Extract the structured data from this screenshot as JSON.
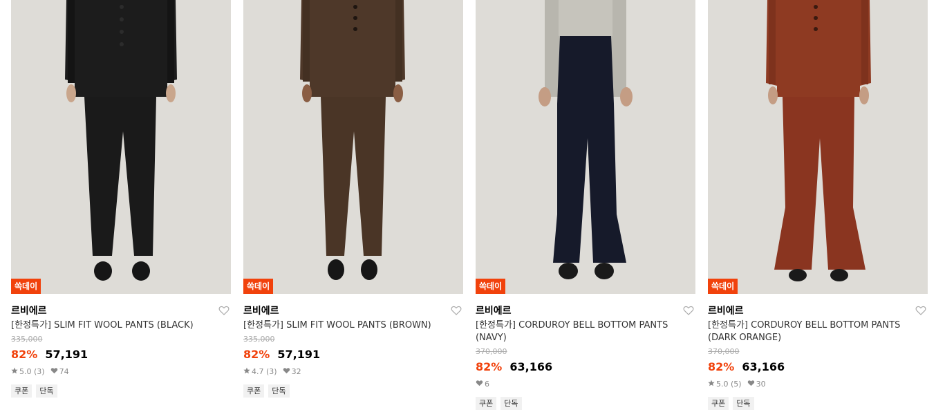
{
  "products": [
    {
      "badge": "쏙데이",
      "brand": "르비에르",
      "name": "[한정특가] SLIM FIT WOOL PANTS (BLACK)",
      "original_price": "335,000",
      "discount": "82%",
      "price": "57,191",
      "rating": "5.0",
      "review_count": "(3)",
      "likes": "74",
      "tags": [
        "쿠폰",
        "단독"
      ],
      "colors": {
        "bg": "#dedcd7",
        "garment": "#1c1c1c",
        "pants": "#1a1a1a"
      }
    },
    {
      "badge": "쏙데이",
      "brand": "르비에르",
      "name": "[한정특가] SLIM FIT WOOL PANTS (BROWN)",
      "original_price": "335,000",
      "discount": "82%",
      "price": "57,191",
      "rating": "4.7",
      "review_count": "(3)",
      "likes": "32",
      "tags": [
        "쿠폰",
        "단독"
      ],
      "colors": {
        "bg": "#dedcd7",
        "garment": "#4e3829",
        "pants": "#4a3526"
      }
    },
    {
      "badge": "쏙데이",
      "brand": "르비에르",
      "name": "[한정특가] CORDUROY BELL BOTTOM PANTS (NAVY)",
      "original_price": "370,000",
      "discount": "82%",
      "price": "63,166",
      "rating": "",
      "review_count": "",
      "likes": "6",
      "tags": [
        "쿠폰",
        "단독"
      ],
      "colors": {
        "bg": "#dedcd7",
        "garment": "#b8b6ae",
        "pants": "#161a2a"
      }
    },
    {
      "badge": "쏙데이",
      "brand": "르비에르",
      "name": "[한정특가] CORDUROY BELL BOTTOM PANTS (DARK ORANGE)",
      "original_price": "370,000",
      "discount": "82%",
      "price": "63,166",
      "rating": "5.0",
      "review_count": "(5)",
      "likes": "30",
      "tags": [
        "쿠폰",
        "단독"
      ],
      "colors": {
        "bg": "#dedcd7",
        "garment": "#8e3a22",
        "pants": "#8a3520"
      }
    }
  ],
  "icons": {
    "wishlist": "heart-outline-icon",
    "rating": "star-icon",
    "likes": "heart-filled-icon"
  }
}
